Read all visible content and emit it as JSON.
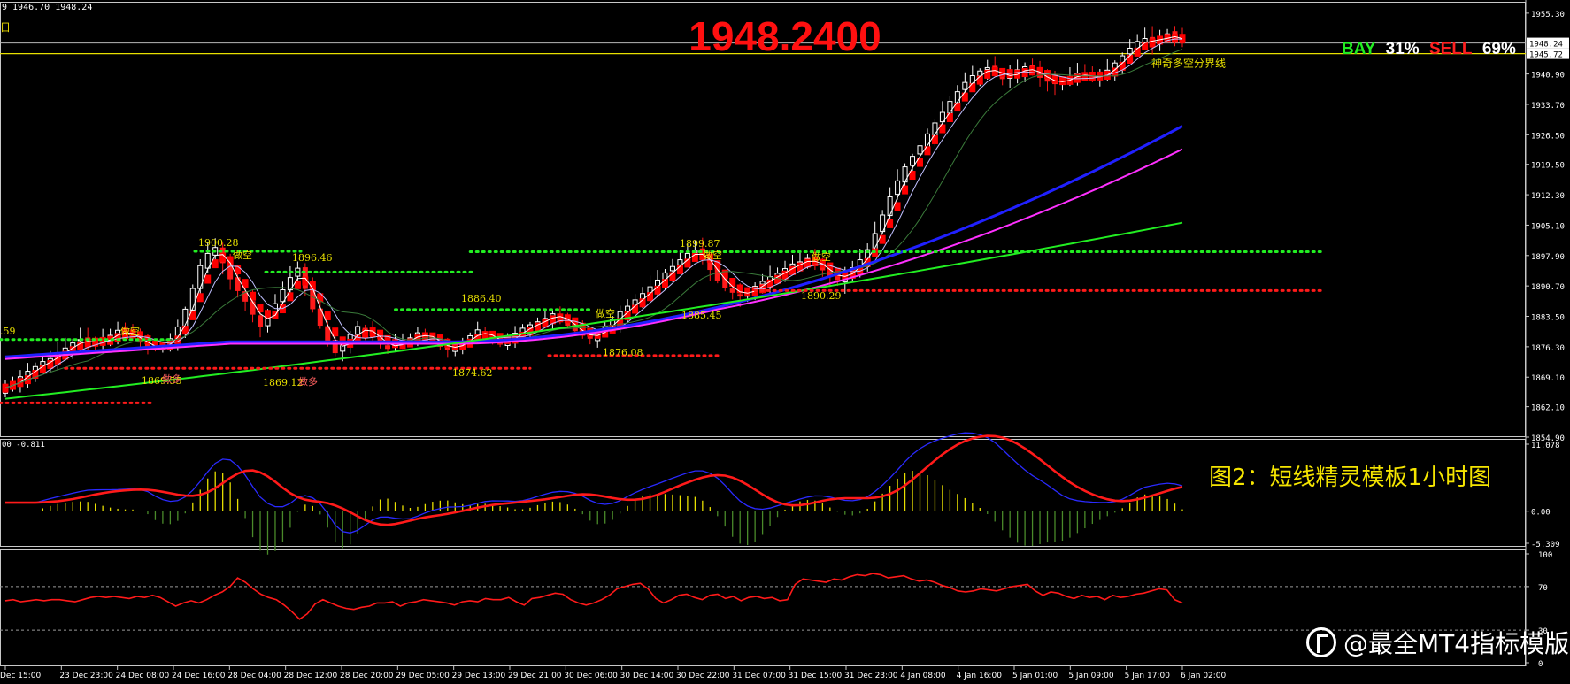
{
  "header": {
    "ohlc_text": "9 1946.70 1948.24",
    "corner_glyph": "日",
    "big_price": "1948.2400",
    "bay_label": "BAY",
    "bay_value": "31%",
    "sell_label": "SELL",
    "sell_value": "69%"
  },
  "macd_info": "00 -0.811",
  "caption": "图2：短线精灵模板1小时图",
  "watermark": "@最全MT4指标模版",
  "colors": {
    "bull": "#ffffff",
    "bear": "#ff1a1a",
    "green": "#22ee22",
    "blue": "#2020ff",
    "magenta": "#ff30ff",
    "yellow": "#e8e000",
    "ribbon": "#ff0000"
  },
  "chart_data": [
    {
      "type": "candlestick",
      "panel": "price",
      "y_ticks": [
        "1955.30",
        "1948.24",
        "1945.72",
        "1940.90",
        "1933.70",
        "1926.50",
        "1919.50",
        "1912.30",
        "1905.10",
        "1897.90",
        "1890.70",
        "1883.50",
        "1876.30",
        "1869.10",
        "1862.10",
        "1854.90"
      ],
      "ylim": [
        1854.9,
        1958.0
      ],
      "current_price": 1948.24,
      "divider_line": 1945.72,
      "divider_label": "神奇多空分界线",
      "x_ticks": [
        "Dec 15:00",
        "23 Dec 23:00",
        "24 Dec 08:00",
        "24 Dec 16:00",
        "28 Dec 04:00",
        "28 Dec 12:00",
        "28 Dec 20:00",
        "29 Dec 05:00",
        "29 Dec 13:00",
        "29 Dec 21:00",
        "30 Dec 06:00",
        "30 Dec 14:00",
        "30 Dec 22:00",
        "31 Dec 07:00",
        "31 Dec 15:00",
        "31 Dec 23:00",
        "4 Jan 08:00",
        "4 Jan 16:00",
        "5 Jan 01:00",
        "5 Jan 09:00",
        "5 Jan 17:00",
        "6 Jan 02:00"
      ],
      "closes": [
        1866.5,
        1867.8,
        1869.2,
        1870.5,
        1871.6,
        1872.8,
        1873.5,
        1874.8,
        1876.0,
        1877.2,
        1878.0,
        1877.5,
        1876.8,
        1877.9,
        1879.0,
        1880.2,
        1879.5,
        1878.6,
        1877.4,
        1876.2,
        1875.8,
        1876.5,
        1878.2,
        1881.0,
        1885.2,
        1890.1,
        1895.5,
        1898.4,
        1899.8,
        1896.2,
        1892.4,
        1889.6,
        1887.1,
        1884.0,
        1881.2,
        1883.6,
        1886.5,
        1889.8,
        1892.7,
        1894.9,
        1890.1,
        1885.3,
        1881.4,
        1877.6,
        1874.9,
        1876.8,
        1879.2,
        1881.1,
        1880.4,
        1878.6,
        1877.0,
        1875.9,
        1876.7,
        1877.8,
        1878.4,
        1879.6,
        1878.9,
        1877.7,
        1876.4,
        1875.6,
        1876.5,
        1877.6,
        1878.9,
        1880.3,
        1879.1,
        1877.8,
        1876.9,
        1878.1,
        1879.5,
        1880.7,
        1881.5,
        1882.2,
        1883.0,
        1884.1,
        1883.2,
        1881.4,
        1880.1,
        1879.0,
        1878.3,
        1879.6,
        1881.2,
        1882.8,
        1884.6,
        1885.9,
        1887.4,
        1888.9,
        1890.5,
        1892.1,
        1893.8,
        1895.3,
        1896.9,
        1898.4,
        1899.2,
        1897.0,
        1894.6,
        1892.1,
        1890.4,
        1889.2,
        1888.3,
        1889.5,
        1890.6,
        1891.8,
        1892.9,
        1893.7,
        1894.8,
        1895.9,
        1896.4,
        1897.2,
        1896.1,
        1894.5,
        1893.1,
        1892.2,
        1893.6,
        1895.0,
        1896.9,
        1899.3,
        1903.1,
        1907.5,
        1911.8,
        1915.6,
        1918.9,
        1921.4,
        1923.9,
        1926.7,
        1929.3,
        1931.8,
        1934.4,
        1936.7,
        1938.9,
        1940.5,
        1941.6,
        1942.4,
        1941.2,
        1939.8,
        1940.6,
        1941.9,
        1942.6,
        1941.3,
        1940.1,
        1939.2,
        1938.6,
        1939.4,
        1940.3,
        1941.1,
        1940.5,
        1939.7,
        1940.4,
        1941.8,
        1943.5,
        1945.2,
        1947.0,
        1948.6,
        1949.3,
        1948.1,
        1949.6,
        1950.4,
        1949.2,
        1948.24
      ],
      "swing_labels": [
        {
          "text": "1900.28",
          "x": 12
        },
        {
          "text": "1896.46",
          "x": 17
        },
        {
          "text": "1869.55",
          "x": 9
        },
        {
          "text": "1869.12",
          "x": 16
        },
        {
          "text": "1874.62",
          "x": 27
        },
        {
          "text": "1886.40",
          "x": 27
        },
        {
          "text": "1899.87",
          "x": 40
        },
        {
          "text": "1885.45",
          "x": 41
        },
        {
          "text": "1876.08",
          "x": 35
        },
        {
          "text": "1890.29",
          "x": 47
        },
        {
          "text": ".59",
          "x": 0
        }
      ],
      "levels": [
        {
          "name": "support_1",
          "value": 1898.8,
          "color": "green"
        },
        {
          "name": "resist_1",
          "value": 1889.6,
          "color": "red"
        },
        {
          "name": "resist_old",
          "value": 1871.2,
          "color": "red"
        },
        {
          "name": "support_old",
          "value": 1878.0,
          "color": "green"
        },
        {
          "name": "support_mid",
          "value": 1885.1,
          "color": "green"
        }
      ],
      "tags": [
        "做空",
        "做多",
        "空",
        "多"
      ]
    },
    {
      "type": "macd",
      "panel": "indicator_1",
      "y_ticks": [
        "11.078",
        "0.00",
        "-5.309"
      ],
      "ylim": [
        -5.309,
        11.078
      ]
    },
    {
      "type": "line",
      "panel": "indicator_2",
      "y_ticks": [
        "100",
        "70",
        "30",
        "0"
      ],
      "ylim": [
        0,
        100
      ],
      "guides": [
        70,
        30
      ],
      "values": [
        57,
        58,
        56,
        57,
        58,
        57,
        58,
        58,
        57,
        56,
        58,
        60,
        61,
        60,
        61,
        60,
        59,
        61,
        60,
        62,
        60,
        56,
        52,
        55,
        57,
        55,
        58,
        62,
        65,
        70,
        78,
        74,
        68,
        63,
        60,
        58,
        53,
        47,
        40,
        45,
        54,
        58,
        55,
        52,
        50,
        49,
        51,
        52,
        55,
        55,
        56,
        52,
        55,
        56,
        58,
        57,
        56,
        55,
        53,
        56,
        57,
        56,
        59,
        58,
        58,
        60,
        56,
        53,
        59,
        60,
        62,
        64,
        63,
        58,
        55,
        53,
        55,
        58,
        62,
        68,
        70,
        72,
        73,
        68,
        59,
        55,
        58,
        62,
        63,
        60,
        58,
        62,
        63,
        59,
        61,
        57,
        60,
        61,
        59,
        60,
        57,
        58,
        72,
        77,
        76,
        75,
        74,
        77,
        76,
        79,
        81,
        80,
        82,
        81,
        78,
        79,
        80,
        77,
        75,
        76,
        74,
        71,
        69,
        66,
        65,
        66,
        68,
        67,
        66,
        68,
        70,
        71,
        72,
        66,
        62,
        65,
        64,
        61,
        59,
        62,
        60,
        61,
        58,
        62,
        60,
        61,
        63,
        64,
        66,
        68,
        67,
        58,
        55
      ]
    }
  ]
}
